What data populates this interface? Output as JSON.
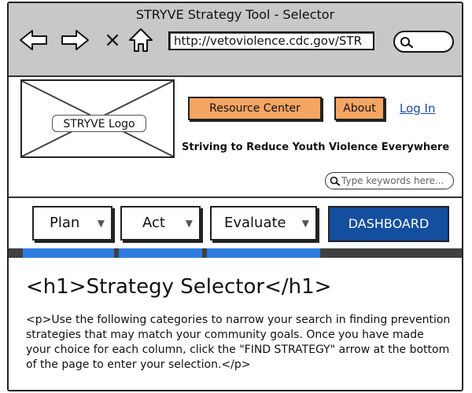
{
  "window": {
    "title": "STRYVE Strategy Tool - Selector"
  },
  "browser": {
    "url": "http://vetoviolence.cdc.gov/STR",
    "back_icon": "arrow-left-icon",
    "forward_icon": "arrow-right-icon",
    "close_icon": "x-icon",
    "home_icon": "home-icon",
    "search_icon": "magnifier-icon"
  },
  "header": {
    "logo_label": "STRYVE Logo",
    "resource_center": "Resource Center",
    "about": "About",
    "login": "Log In",
    "tagline": "Striving to Reduce Youth Violence Everywhere",
    "search_placeholder": "Type keywords here..."
  },
  "nav": {
    "items": [
      {
        "label": "Plan"
      },
      {
        "label": "Act"
      },
      {
        "label": "Evaluate"
      }
    ],
    "dashboard": "DASHBOARD"
  },
  "content": {
    "heading": "<h1>Strategy Selector</h1>",
    "paragraph": "<p>Use the following categories to narrow your search in finding prevention strategies that may match your community goals. Once you have made your choice for each column, click the \"FIND STRATEGY\" arrow at the bottom of the page to enter your selection.</p>"
  },
  "colors": {
    "accent_blue": "#144e9e",
    "stripe_blue": "#2f7ce0",
    "orange": "#f5a562",
    "chrome_gray": "#c8c8c8"
  }
}
